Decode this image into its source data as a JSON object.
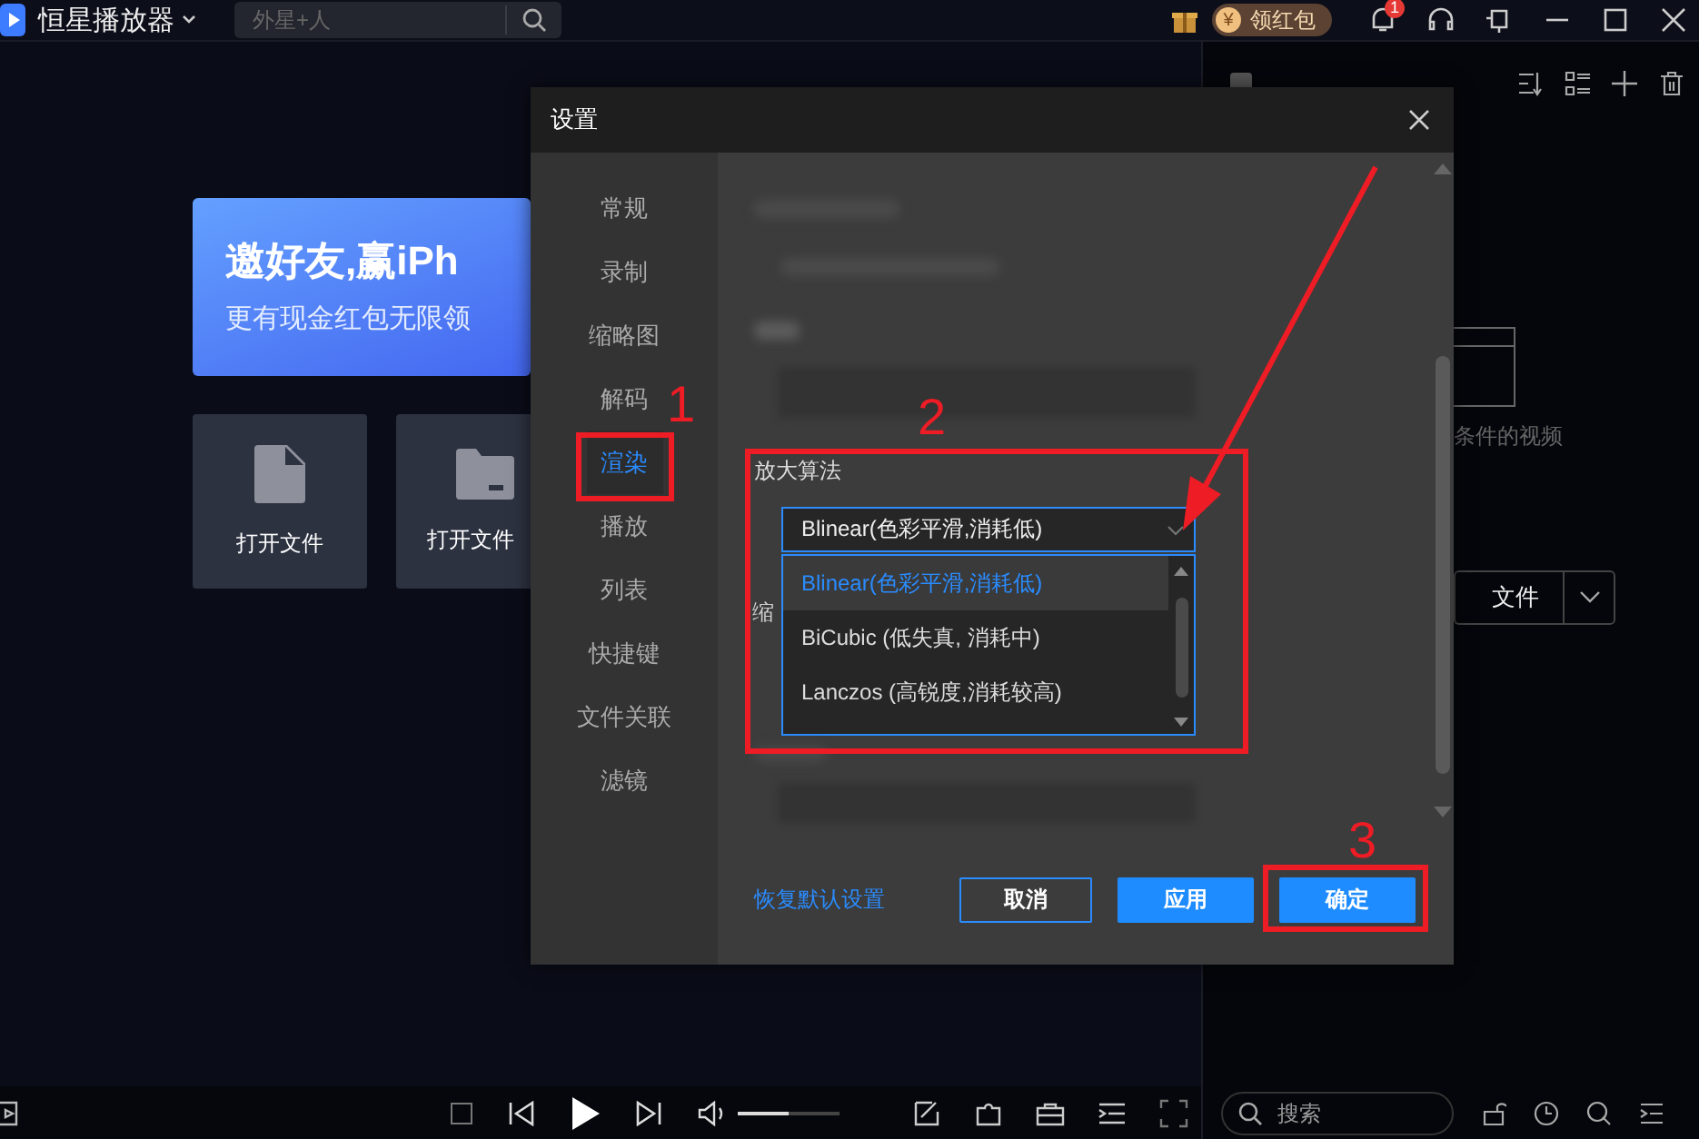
{
  "app": {
    "title": "恒星播放器",
    "search": {
      "placeholder": "外星+人"
    },
    "red_packet": "领红包",
    "coin": "¥",
    "notification_count": "1"
  },
  "banner": {
    "title": "邀好友,赢iPh",
    "subtitle": "更有现金红包无限领"
  },
  "tiles": [
    {
      "kind": "file",
      "label": "打开文件"
    },
    {
      "kind": "folder",
      "label": "打开文件"
    }
  ],
  "playlist": {
    "select_all": {
      "checked": false
    },
    "empty_text": "条件的视频",
    "open_button": "文件",
    "search": {
      "placeholder": "搜索"
    }
  },
  "player": {
    "volume": {
      "level": 0.5
    }
  },
  "dialog": {
    "title": "设置",
    "nav": [
      {
        "label": "常规",
        "selected": false
      },
      {
        "label": "录制",
        "selected": false
      },
      {
        "label": "缩略图",
        "selected": false
      },
      {
        "label": "解码",
        "selected": false
      },
      {
        "label": "渲染",
        "selected": true
      },
      {
        "label": "播放",
        "selected": false
      },
      {
        "label": "列表",
        "selected": false
      },
      {
        "label": "快捷键",
        "selected": false
      },
      {
        "label": "文件关联",
        "selected": false
      },
      {
        "label": "滤镜",
        "selected": false
      }
    ],
    "section_label": "放大算法",
    "dropdown": {
      "value": "Blinear(色彩平滑,消耗低)",
      "options": [
        {
          "label": "Blinear(色彩平滑,消耗低)",
          "selected": true
        },
        {
          "label": "BiCubic (低失真, 消耗中)",
          "selected": false
        },
        {
          "label": "Lanczos (高锐度,消耗较高)",
          "selected": false
        }
      ]
    },
    "partial_label": "缩",
    "reset_link": "恢复默认设置",
    "buttons": [
      {
        "kind": "secondary",
        "label": "取消"
      },
      {
        "kind": "primary",
        "label": "应用"
      },
      {
        "kind": "primary",
        "label": "确定"
      }
    ]
  },
  "annotations": [
    {
      "number": "1"
    },
    {
      "number": "2"
    },
    {
      "number": "3"
    }
  ]
}
